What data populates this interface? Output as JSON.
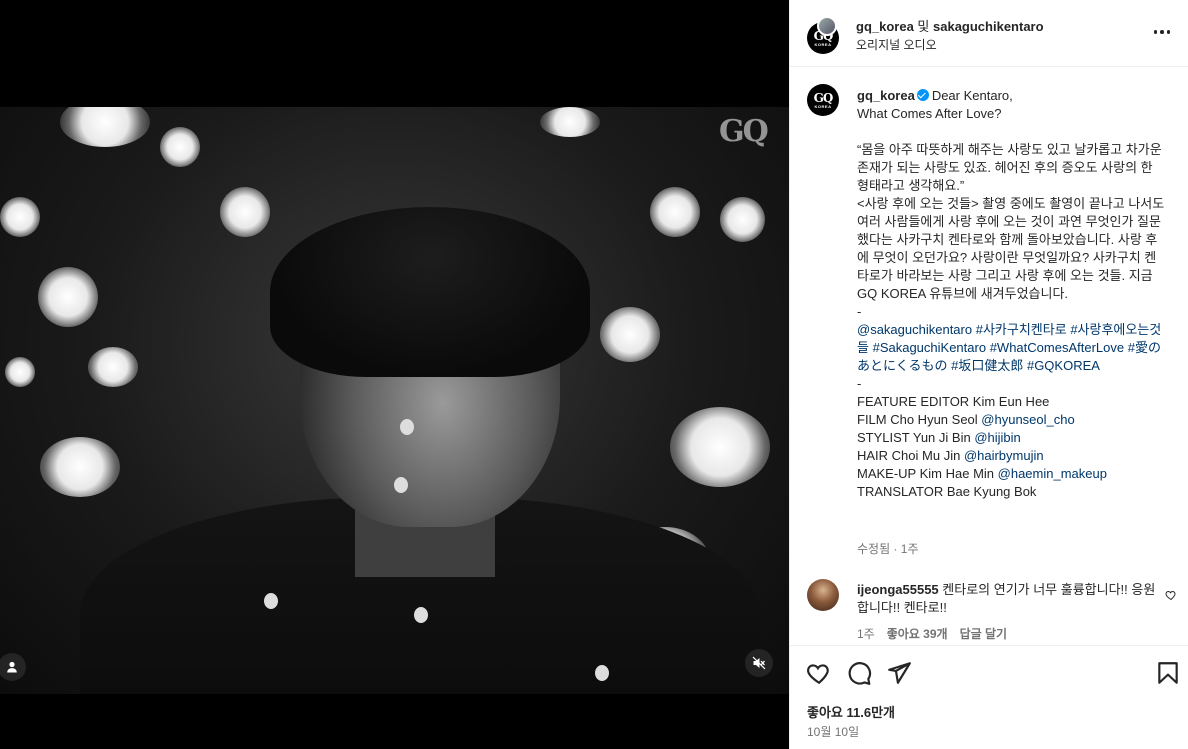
{
  "post": {
    "header": {
      "primary_user": "gq_korea",
      "joiner": " 및 ",
      "secondary_user": "sakaguchikentaro",
      "audio": "오리지널 오디오"
    },
    "media": {
      "watermark": "GQ"
    },
    "caption": {
      "username": "gq_korea",
      "lines": [
        "Dear Kentaro,",
        "What Comes After Love?"
      ],
      "quote": "“몸을 아주 따뜻하게 해주는 사랑도 있고 날카롭고 차가운 존재가 되는 사랑도 있죠. 헤어진 후의 증오도 사랑의 한 형태라고 생각해요.”",
      "body": "<사랑 후에 오는 것들> 촬영 중에도 촬영이 끝나고 나서도 여러 사람들에게 사랑 후에 오는 것이 과연 무엇인가 질문했다는 사카구치 켄타로와 함께 돌아보았습니다. 사랑 후에 무엇이 오던가요? 사랑이란 무엇일까요? 사카구치 켄타로가 바라보는 사랑 그리고 사랑 후에 오는 것들. 지금 GQ KOREA 유튜브에 새겨두었습니다.",
      "dash1": "-",
      "tags": [
        "@sakaguchikentaro",
        "#사카구치켄타로",
        "#사랑후에오는것들",
        "#SakaguchiKentaro",
        "#WhatComesAfterLove",
        "#愛のあとにくるもの",
        "#坂口健太郎",
        "#GQKOREA"
      ],
      "dash2": "-",
      "credits": [
        {
          "role": "FEATURE EDITOR Kim Eun Hee",
          "handle": ""
        },
        {
          "role": "FILM Cho Hyun Seol",
          "handle": "@hyunseol_cho"
        },
        {
          "role": "STYLIST Yun Ji Bin",
          "handle": "@hijibin"
        },
        {
          "role": "HAIR Choi Mu Jin",
          "handle": "@hairbymujin"
        },
        {
          "role": "MAKE-UP Kim Hae Min",
          "handle": "@haemin_makeup"
        },
        {
          "role": "TRANSLATOR Bae Kyung Bok",
          "handle": ""
        }
      ],
      "edited": "수정됨 · 1주"
    },
    "comment": {
      "username": "ijeonga55555",
      "text": "켄타로의 연기가 너무 훌륭합니다!! 응원합니다!! 켄타로!!",
      "time": "1주",
      "likes": "좋아요 39개",
      "reply": "답글 달기"
    },
    "footer": {
      "likes": "좋아요 11.6만개",
      "date": "10월 10일"
    }
  },
  "icons": {
    "like": "heart-icon",
    "comment": "comment-icon",
    "share": "send-icon",
    "save": "bookmark-icon",
    "mute": "speaker-muted-icon",
    "tags": "user-tag-icon",
    "more": "more-options-icon"
  },
  "colors": {
    "link": "#00376b",
    "verified": "#0095f6",
    "muted_text": "#737373",
    "text": "#262626"
  }
}
